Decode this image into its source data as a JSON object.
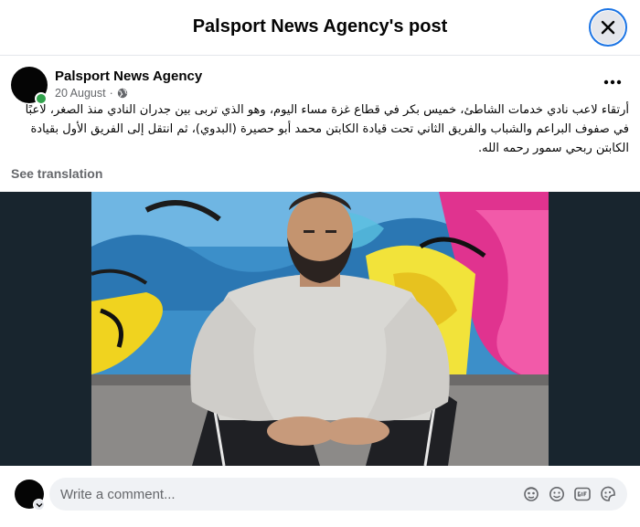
{
  "modal": {
    "title": "Palsport News Agency's post",
    "close_icon": "close-icon"
  },
  "post": {
    "author": "Palsport News Agency",
    "date": "20 August",
    "separator": "·",
    "audience_icon": "globe-icon",
    "body": "أرتقاء لاعب نادي خدمات الشاطئ، خميس بكر  في قطاع غزة مساء اليوم، وهو الذي تربى بين جدران النادي منذ الصغر، لاعبًا في صفوف البراعم والشباب والفريق الثاني تحت قيادة الكابتن محمد أبو حصيرة (البدوي)، ثم انتقل إلى الفريق الأول بقيادة الكابتن ربحي سمور رحمه الله.",
    "see_translation": "See translation",
    "more_icon": "more-options-icon"
  },
  "comment": {
    "placeholder": "Write a comment...",
    "icons": [
      "avatar-sticker-icon",
      "emoji-icon",
      "gif-icon",
      "sticker-icon"
    ]
  },
  "colors": {
    "accent": "#1b74e4",
    "online": "#31a24c",
    "photo_background": "#18252e"
  }
}
